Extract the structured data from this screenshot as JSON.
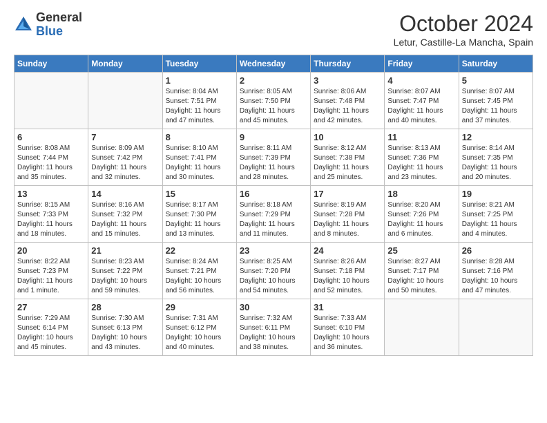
{
  "header": {
    "logo_general": "General",
    "logo_blue": "Blue",
    "month_title": "October 2024",
    "location": "Letur, Castille-La Mancha, Spain"
  },
  "weekdays": [
    "Sunday",
    "Monday",
    "Tuesday",
    "Wednesday",
    "Thursday",
    "Friday",
    "Saturday"
  ],
  "weeks": [
    [
      {
        "day": "",
        "info": ""
      },
      {
        "day": "",
        "info": ""
      },
      {
        "day": "1",
        "info": "Sunrise: 8:04 AM\nSunset: 7:51 PM\nDaylight: 11 hours and 47 minutes."
      },
      {
        "day": "2",
        "info": "Sunrise: 8:05 AM\nSunset: 7:50 PM\nDaylight: 11 hours and 45 minutes."
      },
      {
        "day": "3",
        "info": "Sunrise: 8:06 AM\nSunset: 7:48 PM\nDaylight: 11 hours and 42 minutes."
      },
      {
        "day": "4",
        "info": "Sunrise: 8:07 AM\nSunset: 7:47 PM\nDaylight: 11 hours and 40 minutes."
      },
      {
        "day": "5",
        "info": "Sunrise: 8:07 AM\nSunset: 7:45 PM\nDaylight: 11 hours and 37 minutes."
      }
    ],
    [
      {
        "day": "6",
        "info": "Sunrise: 8:08 AM\nSunset: 7:44 PM\nDaylight: 11 hours and 35 minutes."
      },
      {
        "day": "7",
        "info": "Sunrise: 8:09 AM\nSunset: 7:42 PM\nDaylight: 11 hours and 32 minutes."
      },
      {
        "day": "8",
        "info": "Sunrise: 8:10 AM\nSunset: 7:41 PM\nDaylight: 11 hours and 30 minutes."
      },
      {
        "day": "9",
        "info": "Sunrise: 8:11 AM\nSunset: 7:39 PM\nDaylight: 11 hours and 28 minutes."
      },
      {
        "day": "10",
        "info": "Sunrise: 8:12 AM\nSunset: 7:38 PM\nDaylight: 11 hours and 25 minutes."
      },
      {
        "day": "11",
        "info": "Sunrise: 8:13 AM\nSunset: 7:36 PM\nDaylight: 11 hours and 23 minutes."
      },
      {
        "day": "12",
        "info": "Sunrise: 8:14 AM\nSunset: 7:35 PM\nDaylight: 11 hours and 20 minutes."
      }
    ],
    [
      {
        "day": "13",
        "info": "Sunrise: 8:15 AM\nSunset: 7:33 PM\nDaylight: 11 hours and 18 minutes."
      },
      {
        "day": "14",
        "info": "Sunrise: 8:16 AM\nSunset: 7:32 PM\nDaylight: 11 hours and 15 minutes."
      },
      {
        "day": "15",
        "info": "Sunrise: 8:17 AM\nSunset: 7:30 PM\nDaylight: 11 hours and 13 minutes."
      },
      {
        "day": "16",
        "info": "Sunrise: 8:18 AM\nSunset: 7:29 PM\nDaylight: 11 hours and 11 minutes."
      },
      {
        "day": "17",
        "info": "Sunrise: 8:19 AM\nSunset: 7:28 PM\nDaylight: 11 hours and 8 minutes."
      },
      {
        "day": "18",
        "info": "Sunrise: 8:20 AM\nSunset: 7:26 PM\nDaylight: 11 hours and 6 minutes."
      },
      {
        "day": "19",
        "info": "Sunrise: 8:21 AM\nSunset: 7:25 PM\nDaylight: 11 hours and 4 minutes."
      }
    ],
    [
      {
        "day": "20",
        "info": "Sunrise: 8:22 AM\nSunset: 7:23 PM\nDaylight: 11 hours and 1 minute."
      },
      {
        "day": "21",
        "info": "Sunrise: 8:23 AM\nSunset: 7:22 PM\nDaylight: 10 hours and 59 minutes."
      },
      {
        "day": "22",
        "info": "Sunrise: 8:24 AM\nSunset: 7:21 PM\nDaylight: 10 hours and 56 minutes."
      },
      {
        "day": "23",
        "info": "Sunrise: 8:25 AM\nSunset: 7:20 PM\nDaylight: 10 hours and 54 minutes."
      },
      {
        "day": "24",
        "info": "Sunrise: 8:26 AM\nSunset: 7:18 PM\nDaylight: 10 hours and 52 minutes."
      },
      {
        "day": "25",
        "info": "Sunrise: 8:27 AM\nSunset: 7:17 PM\nDaylight: 10 hours and 50 minutes."
      },
      {
        "day": "26",
        "info": "Sunrise: 8:28 AM\nSunset: 7:16 PM\nDaylight: 10 hours and 47 minutes."
      }
    ],
    [
      {
        "day": "27",
        "info": "Sunrise: 7:29 AM\nSunset: 6:14 PM\nDaylight: 10 hours and 45 minutes."
      },
      {
        "day": "28",
        "info": "Sunrise: 7:30 AM\nSunset: 6:13 PM\nDaylight: 10 hours and 43 minutes."
      },
      {
        "day": "29",
        "info": "Sunrise: 7:31 AM\nSunset: 6:12 PM\nDaylight: 10 hours and 40 minutes."
      },
      {
        "day": "30",
        "info": "Sunrise: 7:32 AM\nSunset: 6:11 PM\nDaylight: 10 hours and 38 minutes."
      },
      {
        "day": "31",
        "info": "Sunrise: 7:33 AM\nSunset: 6:10 PM\nDaylight: 10 hours and 36 minutes."
      },
      {
        "day": "",
        "info": ""
      },
      {
        "day": "",
        "info": ""
      }
    ]
  ]
}
